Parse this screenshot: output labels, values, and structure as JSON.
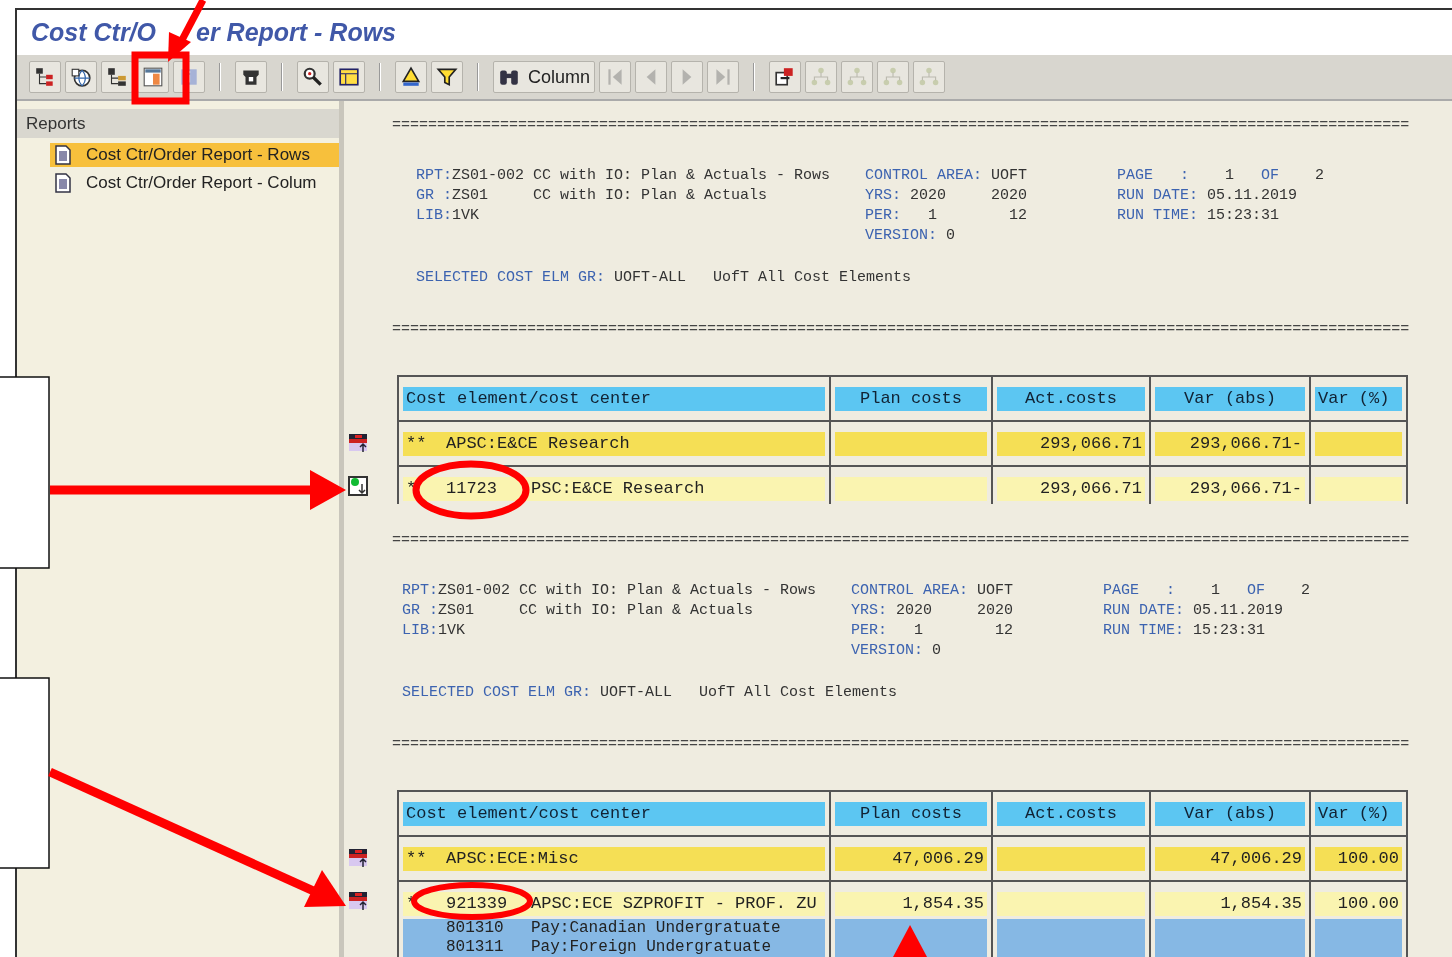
{
  "window": {
    "title_parts": [
      "Cost Ctr/O",
      "er Report - Rows"
    ]
  },
  "toolbar": {
    "groups": [
      [
        {
          "disabled": false
        },
        {
          "disabled": false
        },
        {
          "disabled": false
        },
        {
          "disabled": false
        },
        {
          "disabled": true
        }
      ],
      [
        {
          "disabled": false
        }
      ],
      [
        {
          "disabled": false
        },
        {
          "disabled": false
        }
      ],
      [
        {
          "disabled": false
        },
        {
          "disabled": false
        }
      ],
      [
        {
          "label": "Column",
          "disabled": false
        },
        {
          "disabled": true
        },
        {
          "disabled": true
        },
        {
          "disabled": true
        },
        {
          "disabled": true
        }
      ],
      [
        {
          "disabled": false
        },
        {
          "disabled": true
        },
        {
          "disabled": true
        },
        {
          "disabled": true
        },
        {
          "disabled": true
        }
      ]
    ]
  },
  "sidebar": {
    "title": "Reports",
    "items": [
      {
        "label": "Cost Ctr/Order Report - Rows",
        "selected": true
      },
      {
        "label": "Cost Ctr/Order Report - Colum",
        "selected": false
      }
    ]
  },
  "reports": [
    {
      "separator_top": "=================================================================================================================",
      "header": [
        [
          [
            {
              "kind": "label",
              "text": "RPT:"
            },
            {
              "kind": "value",
              "text": "ZS01-002 CC with IO: Plan & Actuals - Rows"
            }
          ],
          [
            {
              "kind": "label",
              "text": "GR :"
            },
            {
              "kind": "value",
              "text": "ZS01     CC with IO: Plan & Actuals"
            }
          ],
          [
            {
              "kind": "label",
              "text": "LIB:"
            },
            {
              "kind": "value",
              "text": "1VK"
            }
          ]
        ],
        [
          [
            {
              "kind": "label",
              "text": "CONTROL AREA: "
            },
            {
              "kind": "value",
              "text": "UOFT"
            }
          ],
          [
            {
              "kind": "label",
              "text": "YRS: "
            },
            {
              "kind": "value",
              "text": "2020     2020"
            }
          ],
          [
            {
              "kind": "label",
              "text": "PER:"
            },
            {
              "kind": "value",
              "text": "   1        12"
            }
          ],
          [
            {
              "kind": "label",
              "text": "VERSION: "
            },
            {
              "kind": "value",
              "text": "0"
            }
          ]
        ],
        [
          [
            {
              "kind": "label",
              "text": "PAGE   :"
            },
            {
              "kind": "value",
              "text": "    1   "
            },
            {
              "kind": "label",
              "text": "OF"
            },
            {
              "kind": "value",
              "text": "    2"
            }
          ],
          [
            {
              "kind": "label",
              "text": "RUN DATE: "
            },
            {
              "kind": "value",
              "text": "05.11.2019"
            }
          ],
          [
            {
              "kind": "label",
              "text": "RUN TIME: "
            },
            {
              "kind": "value",
              "text": "15:23:31"
            }
          ]
        ]
      ],
      "selection": [
        {
          "kind": "label",
          "text": "SELECTED COST ELM GR: "
        },
        {
          "kind": "value",
          "text": "UOFT-ALL   UofT All Cost Elements"
        }
      ],
      "separator_bottom": "=================================================================================================================",
      "table": {
        "columns": [
          "Cost element/cost center",
          "Plan costs",
          "Act.costs",
          "Var (abs)",
          "Var (%)"
        ],
        "rows": [
          {
            "kind": "total",
            "drilldown": false,
            "marker": "**",
            "label": "APSC:E&CE Research",
            "values": {
              "act_costs": "293,066.71",
              "var_abs": "293,066.71-"
            }
          },
          {
            "kind": "item",
            "drilldown": true,
            "marker": "*",
            "code": "11723",
            "label": "PSC:E&CE Research",
            "values": {
              "act_costs": "293,066.71",
              "var_abs": "293,066.71-"
            }
          }
        ]
      }
    },
    {
      "separator_top": "=================================================================================================================",
      "header": [
        [
          [
            {
              "kind": "label",
              "text": "RPT:"
            },
            {
              "kind": "value",
              "text": "ZS01-002 CC with IO: Plan & Actuals - Rows"
            }
          ],
          [
            {
              "kind": "label",
              "text": "GR :"
            },
            {
              "kind": "value",
              "text": "ZS01     CC with IO: Plan & Actuals"
            }
          ],
          [
            {
              "kind": "label",
              "text": "LIB:"
            },
            {
              "kind": "value",
              "text": "1VK"
            }
          ]
        ],
        [
          [
            {
              "kind": "label",
              "text": "CONTROL AREA: "
            },
            {
              "kind": "value",
              "text": "UOFT"
            }
          ],
          [
            {
              "kind": "label",
              "text": "YRS: "
            },
            {
              "kind": "value",
              "text": "2020     2020"
            }
          ],
          [
            {
              "kind": "label",
              "text": "PER:"
            },
            {
              "kind": "value",
              "text": "   1        12"
            }
          ],
          [
            {
              "kind": "label",
              "text": "VERSION: "
            },
            {
              "kind": "value",
              "text": "0"
            }
          ]
        ],
        [
          [
            {
              "kind": "label",
              "text": "PAGE   :"
            },
            {
              "kind": "value",
              "text": "    1   "
            },
            {
              "kind": "label",
              "text": "OF"
            },
            {
              "kind": "value",
              "text": "    2"
            }
          ],
          [
            {
              "kind": "label",
              "text": "RUN DATE: "
            },
            {
              "kind": "value",
              "text": "05.11.2019"
            }
          ],
          [
            {
              "kind": "label",
              "text": "RUN TIME: "
            },
            {
              "kind": "value",
              "text": "15:23:31"
            }
          ]
        ]
      ],
      "selection": [
        {
          "kind": "label",
          "text": "SELECTED COST ELM GR: "
        },
        {
          "kind": "value",
          "text": "UOFT-ALL   UofT All Cost Elements"
        }
      ],
      "separator_bottom": "=================================================================================================================",
      "table": {
        "columns": [
          "Cost element/cost center",
          "Plan costs",
          "Act.costs",
          "Var (abs)",
          "Var (%)"
        ],
        "rows": [
          {
            "kind": "total",
            "drilldown": false,
            "marker": "**",
            "label": "APSC:ECE:Misc",
            "values": {
              "plan_costs": "47,006.29",
              "var_abs": "47,006.29",
              "var_pct": "100.00"
            }
          },
          {
            "kind": "item",
            "drilldown": false,
            "marker": "*",
            "code": "921339",
            "label": "APSC:ECE SZPROFIT - PROF. ZU",
            "values": {
              "plan_costs": "1,854.35",
              "var_abs": "1,854.35",
              "var_pct": "100.00"
            }
          },
          {
            "kind": "sub",
            "code": "801310",
            "label": "Pay:Canadian Undergratuate",
            "values": {}
          },
          {
            "kind": "sub",
            "code": "801311",
            "label": "Pay:Foreign Undergratuate",
            "values": {}
          }
        ]
      }
    }
  ]
}
